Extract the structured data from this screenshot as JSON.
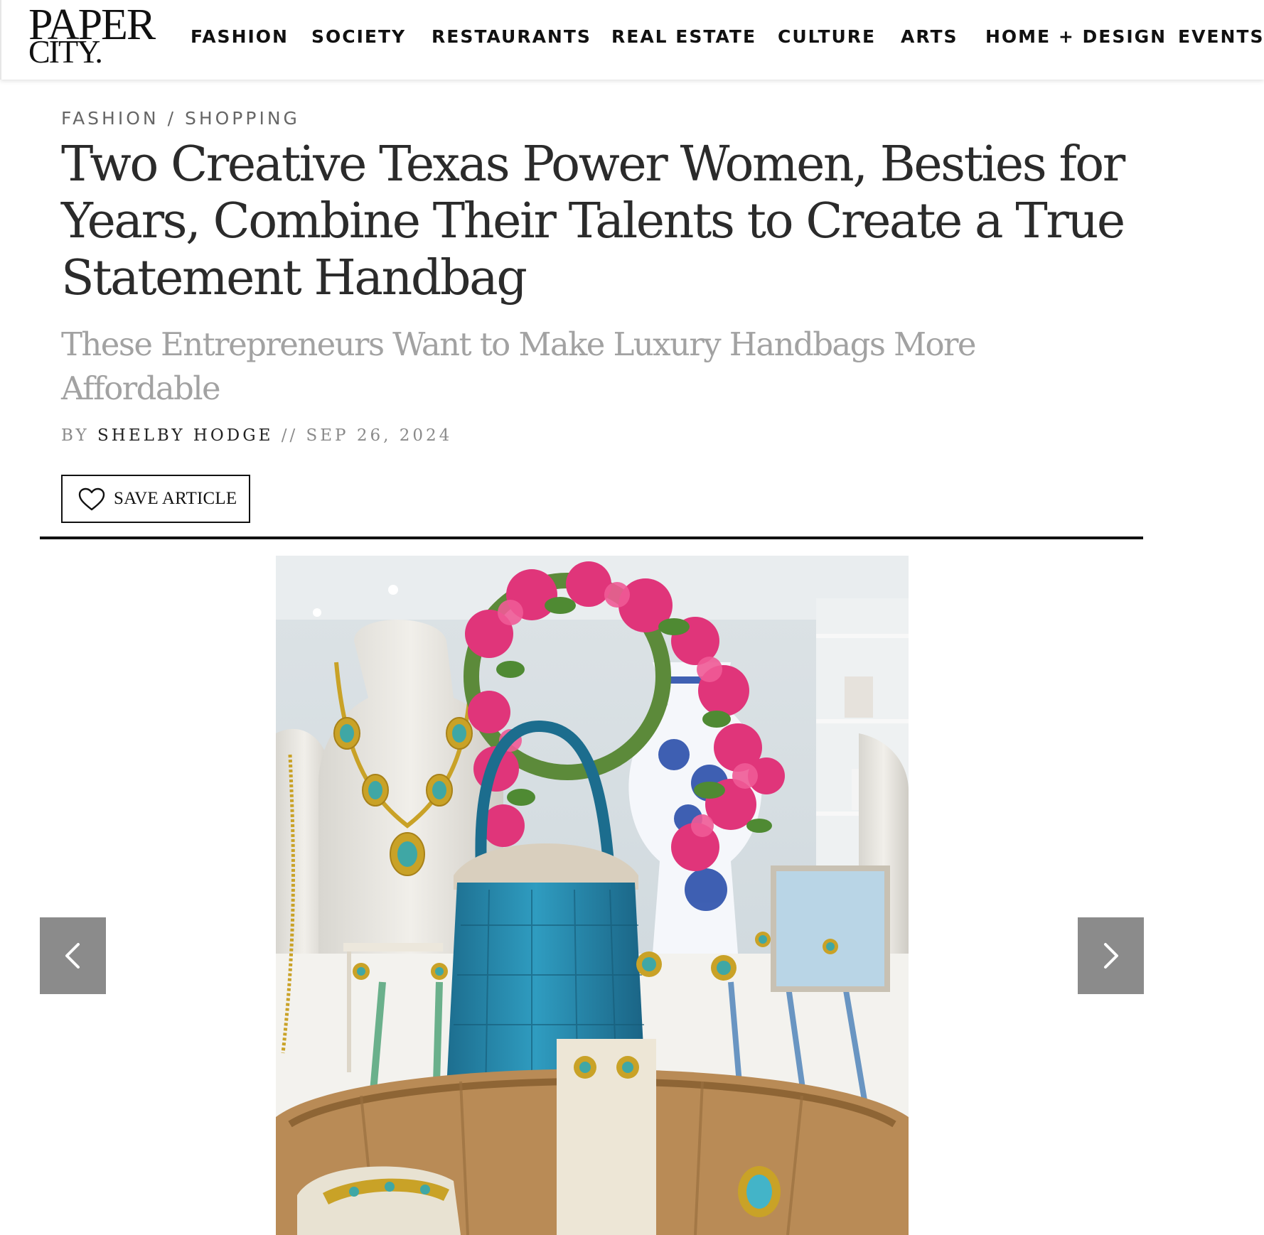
{
  "site": {
    "logo_line1": "PAPER",
    "logo_line2": "CITY."
  },
  "nav": {
    "items": [
      {
        "label": "FASHION"
      },
      {
        "label": "SOCIETY"
      },
      {
        "label": "RESTAURANTS"
      },
      {
        "label": "REAL ESTATE"
      },
      {
        "label": "CULTURE"
      },
      {
        "label": "ARTS"
      },
      {
        "label": "HOME + DESIGN"
      },
      {
        "label": "EVENTS"
      }
    ]
  },
  "article": {
    "breadcrumb": {
      "section": "FASHION",
      "separator": "/",
      "subsection": "SHOPPING"
    },
    "title": "Two Creative Texas Power Women, Besties for Years, Combine Their Talents to Create a True Statement Handbag",
    "subtitle": "These Entrepreneurs Want to Make Luxury Handbags More Affordable",
    "byline": {
      "by": "BY",
      "author": "SHELBY HODGE",
      "separator": "//",
      "date": "SEP 26, 2024"
    },
    "save_label": "SAVE ARTICLE"
  },
  "slideshow": {
    "prev_icon": "chevron-left-icon",
    "next_icon": "chevron-right-icon"
  },
  "colors": {
    "accent": "#111111",
    "arrow_bg": "#8b8b8b",
    "subtitle": "#a2a2a2",
    "meta": "#666666"
  }
}
